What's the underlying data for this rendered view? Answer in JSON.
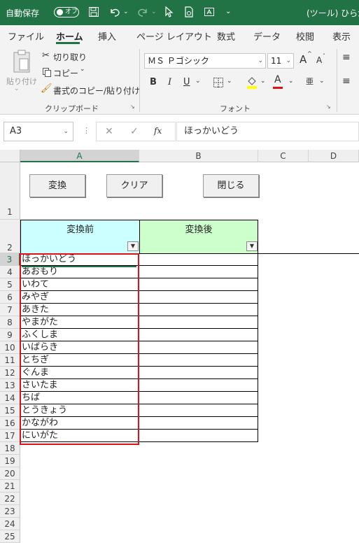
{
  "titlebar": {
    "autosave_label": "自動保存",
    "autosave_state": "オフ",
    "doc_title": "(ツール) ひらが",
    "icons": [
      "save-icon",
      "undo-icon",
      "redo-icon",
      "pointer-icon",
      "file-icon",
      "camera-icon",
      "customize-icon"
    ]
  },
  "tabs": [
    "ファイル",
    "ホーム",
    "挿入",
    "ページ レイアウト",
    "数式",
    "データ",
    "校閲",
    "表示"
  ],
  "ribbon": {
    "paste": "貼り付け",
    "cut": "切り取り",
    "copy": "コピー",
    "format_painter": "書式のコピー/貼り付け",
    "clipboard_group": "クリップボード",
    "font_name": "ＭＳ Ｐゴシック",
    "font_size": "11",
    "font_group": "フォント",
    "bold": "B",
    "italic": "I",
    "underline": "U",
    "grow": "A",
    "shrink": "A",
    "furigana": "亜",
    "fx": "fx",
    "accent_red": "#e0101a",
    "accent_yellow": "#ffff00"
  },
  "formula_bar": {
    "name_box": "A3",
    "formula": "ほっかいどう"
  },
  "sheet": {
    "columns": [
      "A",
      "B",
      "C",
      "D"
    ],
    "rows": [
      "1",
      "2",
      "3",
      "4",
      "5",
      "6",
      "7",
      "8",
      "9",
      "10",
      "11",
      "12",
      "13",
      "14",
      "15",
      "16",
      "17",
      "18",
      "19",
      "20",
      "21",
      "22",
      "23",
      "24",
      "25"
    ],
    "buttons": {
      "convert": "変換",
      "clear": "クリア",
      "close": "閉じる"
    },
    "header_before": "変換前",
    "header_after": "変換後",
    "header_before_color": "#ccffff",
    "header_after_color": "#ccffcc",
    "values": [
      "ほっかいどう",
      "あおもり",
      "いわて",
      "みやぎ",
      "あきた",
      "やまがた",
      "ふくしま",
      "いばらき",
      "とちぎ",
      "ぐんま",
      "さいたま",
      "ちば",
      "とうきょう",
      "かながわ",
      "にいがた"
    ]
  }
}
